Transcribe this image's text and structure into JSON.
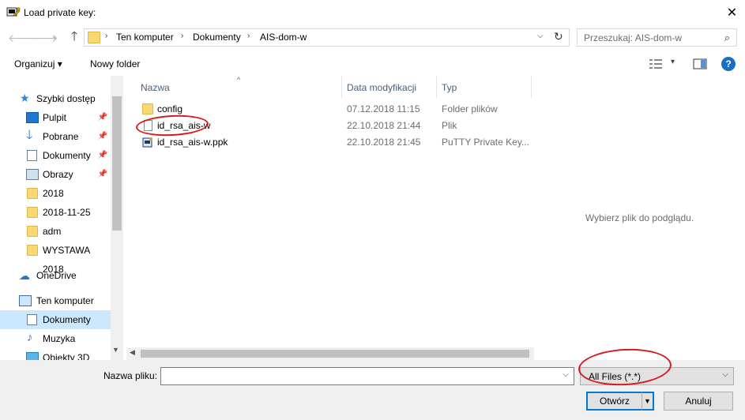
{
  "window": {
    "title": "Load private key:",
    "close_glyph": "✕"
  },
  "address": {
    "crumbs": [
      "Ten komputer",
      "Dokumenty",
      "AIS-dom-w"
    ],
    "separator": "›"
  },
  "search": {
    "placeholder": "Przeszukaj: AIS-dom-w"
  },
  "toolbar": {
    "organize_label": "Organizuj ▾",
    "new_folder_label": "Nowy folder",
    "help_label": "?"
  },
  "nav": {
    "items": [
      {
        "label": "Szybki dostęp",
        "icon": "star-icon"
      },
      {
        "label": "Pulpit",
        "icon": "desktop-icon",
        "pinned": true
      },
      {
        "label": "Pobrane",
        "icon": "download-icon",
        "pinned": true
      },
      {
        "label": "Dokumenty",
        "icon": "documents-icon",
        "pinned": true
      },
      {
        "label": "Obrazy",
        "icon": "pictures-icon",
        "pinned": true
      },
      {
        "label": "2018",
        "icon": "folder-icon"
      },
      {
        "label": "2018-11-25",
        "icon": "folder-icon"
      },
      {
        "label": "adm",
        "icon": "folder-icon"
      },
      {
        "label": "WYSTAWA 2018",
        "icon": "folder-icon"
      },
      {
        "label": "OneDrive",
        "icon": "cloud-icon"
      },
      {
        "label": "Ten komputer",
        "icon": "computer-icon"
      },
      {
        "label": "Dokumenty",
        "icon": "documents-icon",
        "selected": true
      },
      {
        "label": "Muzyka",
        "icon": "music-icon"
      },
      {
        "label": "Obiekty 3D",
        "icon": "3d-objects-icon"
      }
    ]
  },
  "file_list": {
    "columns": [
      "Nazwa",
      "Data modyfikacji",
      "Typ"
    ],
    "rows": [
      {
        "name": "config",
        "date": "07.12.2018 11:15",
        "type": "Folder plików",
        "icon": "folder-icon"
      },
      {
        "name": "id_rsa_ais-w",
        "date": "22.10.2018 21:44",
        "type": "Plik",
        "icon": "file-icon"
      },
      {
        "name": "id_rsa_ais-w.ppk",
        "date": "22.10.2018 21:45",
        "type": "PuTTY Private Key...",
        "icon": "putty-key-icon"
      }
    ]
  },
  "preview": {
    "message": "Wybierz plik do podglądu."
  },
  "bottom": {
    "filename_label": "Nazwa pliku:",
    "filename_value": "",
    "filetype_value": "All Files (*.*)",
    "open_label": "Otwórz",
    "cancel_label": "Anuluj"
  },
  "colors": {
    "accent": "#0078d7",
    "annotation": "#d81b1b",
    "folder": "#f8d775",
    "selection": "#cce8ff"
  }
}
